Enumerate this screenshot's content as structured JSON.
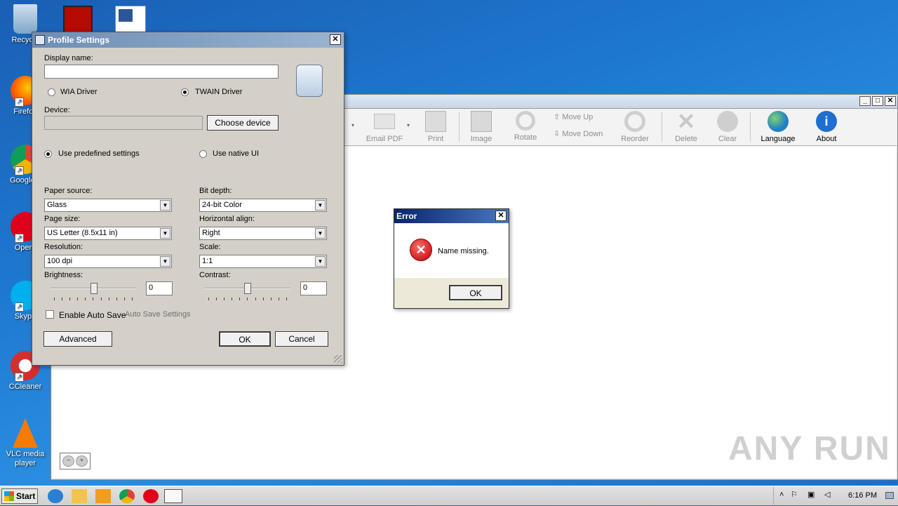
{
  "desktop": {
    "icons": [
      {
        "label": "Recycle",
        "icon": "recycle-bin-icon"
      },
      {
        "label": "Firefox",
        "icon": "firefox-icon"
      },
      {
        "label": "Google Chrome",
        "icon": "chrome-icon"
      },
      {
        "label": "Opera",
        "icon": "opera-icon"
      },
      {
        "label": "Skype",
        "icon": "skype-icon"
      },
      {
        "label": "CCleaner",
        "icon": "ccleaner-icon"
      },
      {
        "label": "VLC media player",
        "icon": "vlc-icon"
      }
    ],
    "top_icons": [
      "acrobat-icon",
      "word-document-icon"
    ]
  },
  "app": {
    "toolbar": [
      {
        "label": "Email PDF",
        "icon": "email-icon",
        "enabled": false
      },
      {
        "label": "Print",
        "icon": "printer-icon",
        "enabled": false
      },
      {
        "label": "Image",
        "icon": "image-edit-icon",
        "enabled": false
      },
      {
        "label": "Rotate",
        "icon": "rotate-icon",
        "enabled": false
      },
      {
        "label": "Move Up",
        "icon": "arrow-up-icon",
        "enabled": false
      },
      {
        "label": "Move Down",
        "icon": "arrow-down-icon",
        "enabled": false
      },
      {
        "label": "Reorder",
        "icon": "reorder-icon",
        "enabled": false
      },
      {
        "label": "Delete",
        "icon": "delete-icon",
        "enabled": false
      },
      {
        "label": "Clear",
        "icon": "clear-icon",
        "enabled": false
      },
      {
        "label": "Language",
        "icon": "globe-icon",
        "enabled": true
      },
      {
        "label": "About",
        "icon": "info-icon",
        "enabled": true
      }
    ]
  },
  "profile_dialog": {
    "title": "Profile Settings",
    "display_name_label": "Display name:",
    "display_name_value": "",
    "wia_label": "WIA Driver",
    "twain_label": "TWAIN Driver",
    "driver_selected": "TWAIN Driver",
    "device_label": "Device:",
    "device_value": "",
    "choose_device": "Choose device",
    "predefined_label": "Use predefined settings",
    "native_label": "Use native UI",
    "paper_source_label": "Paper source:",
    "paper_source_value": "Glass",
    "page_size_label": "Page size:",
    "page_size_value": "US Letter (8.5x11 in)",
    "resolution_label": "Resolution:",
    "resolution_value": "100 dpi",
    "brightness_label": "Brightness:",
    "brightness_value": "0",
    "bit_depth_label": "Bit depth:",
    "bit_depth_value": "24-bit Color",
    "halign_label": "Horizontal align:",
    "halign_value": "Right",
    "scale_label": "Scale:",
    "scale_value": "1:1",
    "contrast_label": "Contrast:",
    "contrast_value": "0",
    "auto_save_label": "Enable Auto Save",
    "auto_save_settings": "Auto Save Settings",
    "advanced": "Advanced",
    "ok": "OK",
    "cancel": "Cancel"
  },
  "error_dialog": {
    "title": "Error",
    "message": "Name missing.",
    "ok": "OK"
  },
  "taskbar": {
    "start": "Start",
    "clock": "6:16 PM"
  },
  "watermark": "ANY RUN"
}
